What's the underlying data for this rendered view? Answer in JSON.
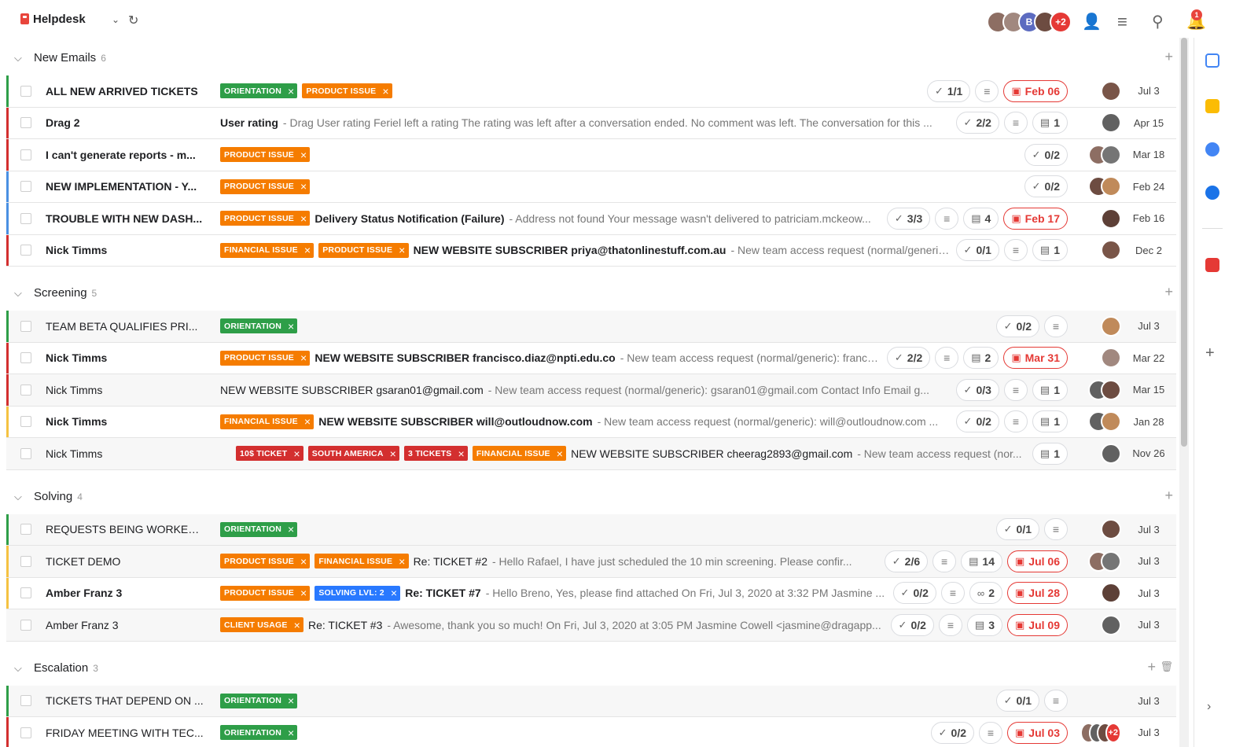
{
  "app": {
    "title": "Helpdesk",
    "notifications": "1"
  },
  "top_avatars": [
    {
      "initial": "",
      "color": "#8d6e63"
    },
    {
      "initial": "",
      "color": "#a1887f"
    },
    {
      "initial": "B",
      "color": "#5c6bc0"
    },
    {
      "initial": "",
      "color": "#6d4c41"
    },
    {
      "initial": "+2",
      "color": "#e53935"
    }
  ],
  "colors": {
    "orientation": "#2e9e48",
    "product_issue": "#f57c00",
    "financial_issue": "#f57c00",
    "red_tag": "#d32f2f",
    "solving_lvl": "#2979ff",
    "client_usage": "#f57c00",
    "stripe_green": "#2e9e48",
    "stripe_red": "#d32f2f",
    "stripe_blue": "#4a90e2",
    "stripe_yellow": "#f5c242"
  },
  "groups": [
    {
      "name": "New Emails",
      "count": "6",
      "delete": false,
      "rows": [
        {
          "stripe": "#2e9e48",
          "title": "ALL NEW ARRIVED TICKETS",
          "bold": true,
          "tags": [
            {
              "label": "ORIENTATION",
              "color": "#2e9e48"
            },
            {
              "label": "PRODUCT ISSUE",
              "color": "#f57c00"
            }
          ],
          "subject": "",
          "subject_bold": false,
          "preview": "",
          "checklist": "1/1",
          "notes": true,
          "comments": "",
          "links": "",
          "due": "Feb 06",
          "avatars": [
            "#795548"
          ],
          "date": "Jul 3"
        },
        {
          "stripe": "#d32f2f",
          "title": "Drag 2",
          "bold": true,
          "tags": [],
          "subject": "User rating",
          "subject_bold": true,
          "preview": "- Drag User rating Feriel left a rating The rating was left after a conversation ended. No comment was left. The conversation for this ...",
          "checklist": "2/2",
          "notes": true,
          "comments": "1",
          "links": "",
          "due": "",
          "avatars": [
            "#616161"
          ],
          "date": "Apr 15"
        },
        {
          "stripe": "#d32f2f",
          "title": "I can't generate reports - m...",
          "bold": true,
          "tags": [
            {
              "label": "PRODUCT ISSUE",
              "color": "#f57c00"
            }
          ],
          "subject": "",
          "subject_bold": false,
          "preview": "",
          "checklist": "0/2",
          "notes": false,
          "comments": "",
          "links": "",
          "due": "",
          "avatars": [
            "#8d6e63",
            "#757575"
          ],
          "date": "Mar 18"
        },
        {
          "stripe": "#4a90e2",
          "title": "NEW IMPLEMENTATION - Y...",
          "bold": true,
          "tags": [
            {
              "label": "PRODUCT ISSUE",
              "color": "#f57c00"
            }
          ],
          "subject": "",
          "subject_bold": false,
          "preview": "",
          "checklist": "0/2",
          "notes": false,
          "comments": "",
          "links": "",
          "due": "",
          "avatars": [
            "#6d4c41",
            "#c08a5a"
          ],
          "date": "Feb 24"
        },
        {
          "stripe": "#4a90e2",
          "title": "TROUBLE WITH NEW DASH...",
          "bold": true,
          "tags": [
            {
              "label": "PRODUCT ISSUE",
              "color": "#f57c00"
            }
          ],
          "subject": "Delivery Status Notification (Failure)",
          "subject_bold": true,
          "preview": "- Address not found Your message wasn't delivered to patriciam.mckeow...",
          "checklist": "3/3",
          "notes": true,
          "comments": "4",
          "links": "",
          "due": "Feb 17",
          "avatars": [
            "#5d4037"
          ],
          "date": "Feb 16"
        },
        {
          "stripe": "#d32f2f",
          "title": "Nick Timms",
          "bold": true,
          "tags": [
            {
              "label": "FINANCIAL ISSUE",
              "color": "#f57c00"
            },
            {
              "label": "PRODUCT ISSUE",
              "color": "#f57c00"
            }
          ],
          "subject": "NEW WEBSITE SUBSCRIBER priya@thatonlinestuff.com.au",
          "subject_bold": true,
          "preview": "- New team access request (normal/generic)...",
          "checklist": "0/1",
          "notes": true,
          "comments": "1",
          "links": "",
          "due": "",
          "avatars": [
            "#795548"
          ],
          "date": "Dec 2"
        }
      ]
    },
    {
      "name": "Screening",
      "count": "5",
      "delete": false,
      "rows": [
        {
          "stripe": "#2e9e48",
          "title": "TEAM BETA QUALIFIES PRI...",
          "bold": false,
          "alt": true,
          "tags": [
            {
              "label": "ORIENTATION",
              "color": "#2e9e48"
            }
          ],
          "subject": "",
          "subject_bold": false,
          "preview": "",
          "checklist": "0/2",
          "notes": true,
          "comments": "",
          "links": "",
          "due": "",
          "avatars": [
            "#c08a5a"
          ],
          "date": "Jul 3"
        },
        {
          "stripe": "#d32f2f",
          "title": "Nick Timms",
          "bold": true,
          "tags": [
            {
              "label": "PRODUCT ISSUE",
              "color": "#f57c00"
            }
          ],
          "subject": "NEW WEBSITE SUBSCRIBER francisco.diaz@npti.edu.co",
          "subject_bold": true,
          "preview": "- New team access request (normal/generic): francis...",
          "checklist": "2/2",
          "notes": true,
          "comments": "2",
          "links": "",
          "due": "Mar 31",
          "avatars": [
            "#a1887f"
          ],
          "date": "Mar 22"
        },
        {
          "stripe": "#d32f2f",
          "title": "Nick Timms",
          "bold": false,
          "alt": true,
          "tags": [],
          "subject": "NEW WEBSITE SUBSCRIBER gsaran01@gmail.com",
          "subject_bold": false,
          "preview": "- New team access request (normal/generic): gsaran01@gmail.com Contact Info Email g...",
          "checklist": "0/3",
          "notes": true,
          "comments": "1",
          "links": "",
          "due": "",
          "avatars": [
            "#616161",
            "#6d4c41"
          ],
          "date": "Mar 15"
        },
        {
          "stripe": "#f5c242",
          "title": "Nick Timms",
          "bold": true,
          "tags": [
            {
              "label": "FINANCIAL ISSUE",
              "color": "#f57c00"
            }
          ],
          "subject": "NEW WEBSITE SUBSCRIBER will@outloudnow.com",
          "subject_bold": true,
          "preview": "- New team access request (normal/generic): will@outloudnow.com ...",
          "checklist": "0/2",
          "notes": true,
          "comments": "1",
          "links": "",
          "due": "",
          "avatars": [
            "#616161",
            "#c08a5a"
          ],
          "date": "Jan 28"
        },
        {
          "stripe": "",
          "title": "Nick Timms",
          "bold": false,
          "alt": true,
          "tags": [
            {
              "label": "10$ TICKET",
              "color": "#d32f2f"
            },
            {
              "label": "SOUTH AMERICA",
              "color": "#d32f2f"
            },
            {
              "label": "3 TICKETS",
              "color": "#d32f2f"
            },
            {
              "label": "FINANCIAL ISSUE",
              "color": "#f57c00"
            }
          ],
          "tag_offset": true,
          "subject": "NEW WEBSITE SUBSCRIBER cheerag2893@gmail.com",
          "subject_bold": false,
          "preview": "- New team access request (nor...",
          "checklist": "",
          "notes": false,
          "comments": "1",
          "links": "",
          "due": "",
          "avatars": [
            "#616161"
          ],
          "date": "Nov 26"
        }
      ]
    },
    {
      "name": "Solving",
      "count": "4",
      "delete": false,
      "rows": [
        {
          "stripe": "#2e9e48",
          "title": "REQUESTS BEING WORKED ...",
          "bold": false,
          "alt": true,
          "tags": [
            {
              "label": "ORIENTATION",
              "color": "#2e9e48"
            }
          ],
          "subject": "",
          "subject_bold": false,
          "preview": "",
          "checklist": "0/1",
          "notes": true,
          "comments": "",
          "links": "",
          "due": "",
          "avatars": [
            "#6d4c41"
          ],
          "date": "Jul 3"
        },
        {
          "stripe": "#f5c242",
          "title": "TICKET DEMO",
          "bold": false,
          "alt": true,
          "tags": [
            {
              "label": "PRODUCT ISSUE",
              "color": "#f57c00"
            },
            {
              "label": "FINANCIAL ISSUE",
              "color": "#f57c00"
            }
          ],
          "subject": "Re: TICKET #2",
          "subject_bold": false,
          "preview": "- Hello Rafael, I have just scheduled the 10 min screening. Please confir...",
          "checklist": "2/6",
          "notes": true,
          "comments": "14",
          "links": "",
          "due": "Jul 06",
          "avatars": [
            "#8d6e63",
            "#757575"
          ],
          "date": "Jul 3"
        },
        {
          "stripe": "#f5c242",
          "title": "Amber Franz 3",
          "bold": true,
          "tags": [
            {
              "label": "PRODUCT ISSUE",
              "color": "#f57c00"
            },
            {
              "label": "SOLVING LVL: 2",
              "color": "#2979ff"
            }
          ],
          "subject": "Re: TICKET #7",
          "subject_bold": true,
          "preview": "- Hello Breno, Yes, please find attached On Fri, Jul 3, 2020 at 3:32 PM Jasmine ...",
          "checklist": "0/2",
          "notes": true,
          "comments": "",
          "links": "2",
          "due": "Jul 28",
          "avatars": [
            "#5d4037"
          ],
          "date": "Jul 3"
        },
        {
          "stripe": "",
          "title": "Amber Franz 3",
          "bold": false,
          "alt": true,
          "tags": [
            {
              "label": "CLIENT USAGE",
              "color": "#f57c00"
            }
          ],
          "subject": "Re: TICKET #3",
          "subject_bold": false,
          "preview": "- Awesome, thank you so much! On Fri, Jul 3, 2020 at 3:05 PM Jasmine Cowell <jasmine@dragapp...",
          "checklist": "0/2",
          "notes": true,
          "comments": "3",
          "links": "",
          "due": "Jul 09",
          "avatars": [
            "#616161"
          ],
          "date": "Jul 3"
        }
      ]
    },
    {
      "name": "Escalation",
      "count": "3",
      "delete": true,
      "rows": [
        {
          "stripe": "#2e9e48",
          "title": "TICKETS THAT DEPEND ON ...",
          "bold": false,
          "alt": true,
          "tags": [
            {
              "label": "ORIENTATION",
              "color": "#2e9e48"
            }
          ],
          "subject": "",
          "subject_bold": false,
          "preview": "",
          "checklist": "0/1",
          "notes": true,
          "comments": "",
          "links": "",
          "due": "",
          "avatars": [],
          "date": "Jul 3"
        },
        {
          "stripe": "#d32f2f",
          "title": "FRIDAY MEETING WITH TEC...",
          "bold": false,
          "tags": [
            {
              "label": "ORIENTATION",
              "color": "#2e9e48"
            }
          ],
          "subject": "",
          "subject_bold": false,
          "preview": "",
          "checklist": "0/2",
          "notes": true,
          "comments": "",
          "links": "",
          "due": "Jul 03",
          "avatars": [
            "#8d6e63",
            "#616161",
            "#6d4c41"
          ],
          "more": "+2",
          "date": "Jul 3"
        }
      ]
    }
  ]
}
